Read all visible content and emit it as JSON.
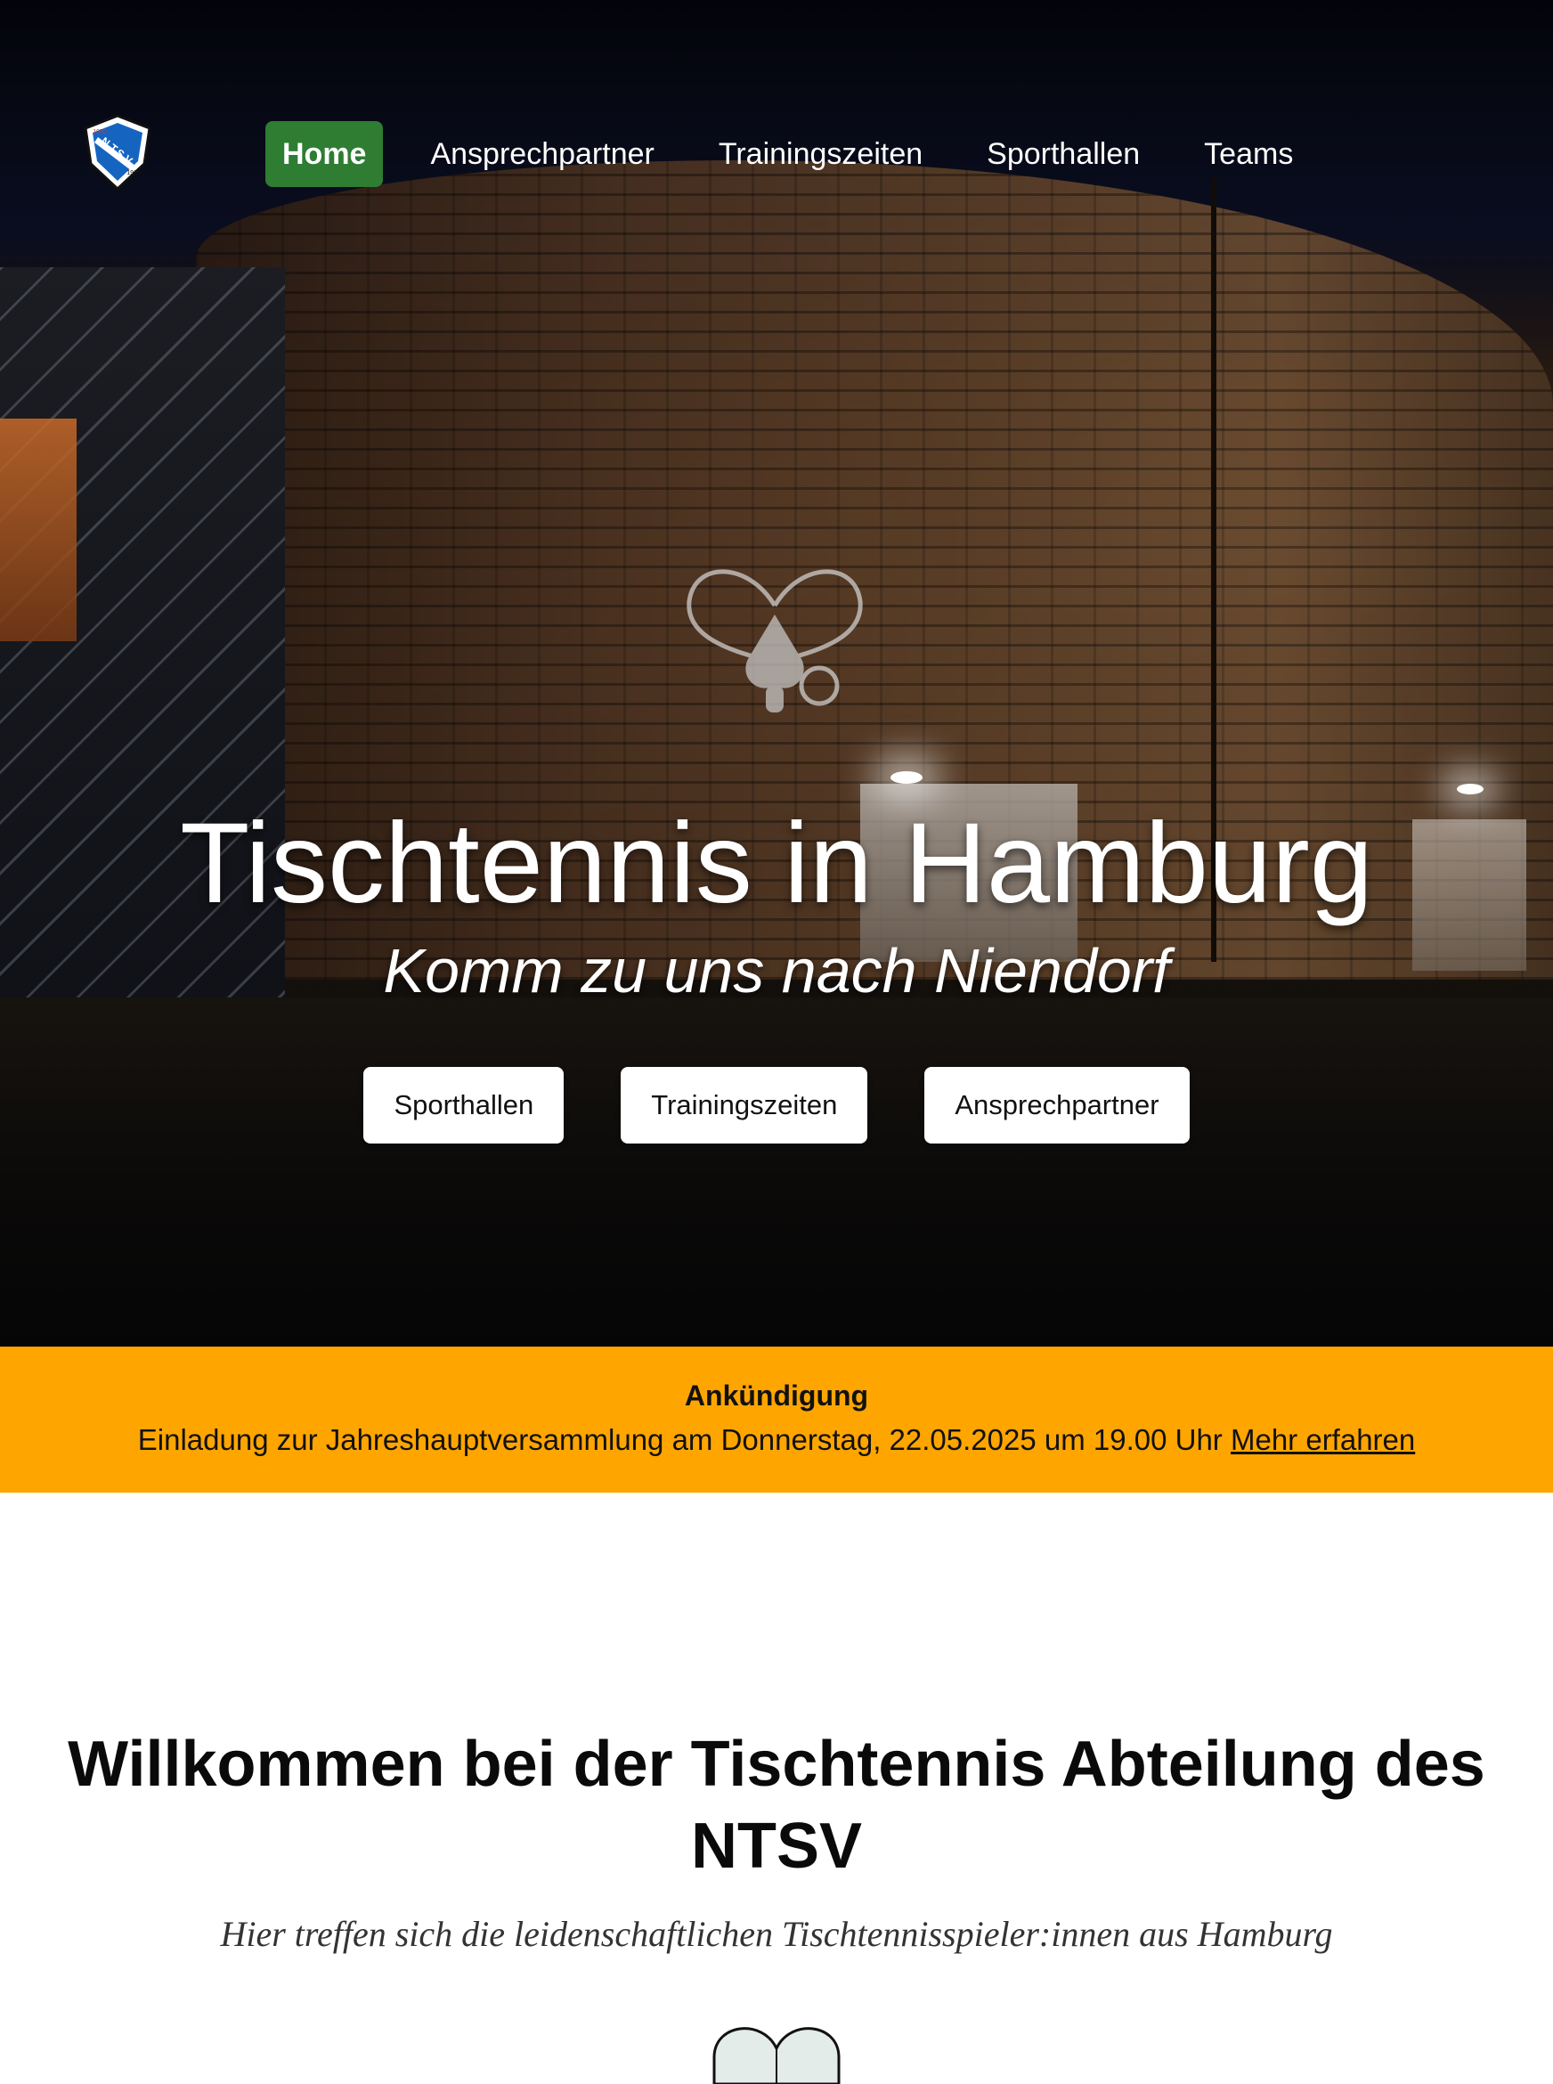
{
  "nav": {
    "logo_icon": "ntsv-club-crest",
    "logo_text": "N.T.S.V.",
    "logo_year_left": "1950",
    "logo_year_right": "1919",
    "items": [
      {
        "label": "Home",
        "active": true
      },
      {
        "label": "Ansprechpartner",
        "active": false
      },
      {
        "label": "Trainingszeiten",
        "active": false
      },
      {
        "label": "Sporthallen",
        "active": false
      },
      {
        "label": "Teams",
        "active": false
      }
    ],
    "active_color": "#2e7d32"
  },
  "hero": {
    "emblem_icon": "table-tennis-paddles-icon",
    "title": "Tischtennis in Hamburg",
    "subtitle": "Komm zu uns nach Niendorf",
    "buttons": [
      {
        "label": "Sporthallen"
      },
      {
        "label": "Trainingszeiten"
      },
      {
        "label": "Ansprechpartner"
      }
    ]
  },
  "announcement": {
    "title": "Ankündigung",
    "text": "Einladung zur Jahreshauptversammlung am Donnerstag, 22.05.2025 um 19.00 Uhr",
    "link_label": "Mehr erfahren",
    "background_color": "#ffa500"
  },
  "welcome": {
    "title": "Willkommen bei der Tischtennis Abteilung des NTSV",
    "subtitle": "Hier treffen sich die leidenschaftlichen Tischtennisspieler:innen aus Hamburg",
    "emblem_icon": "table-tennis-paddles-icon"
  }
}
